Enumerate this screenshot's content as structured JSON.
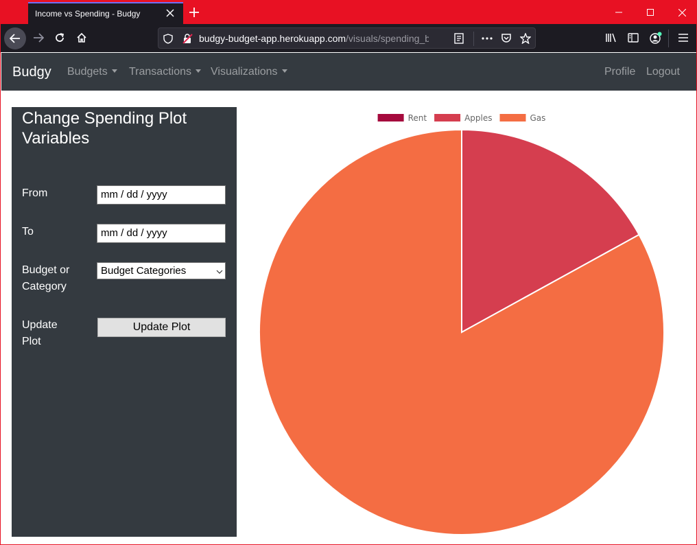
{
  "browser": {
    "tab_title": "Income vs Spending - Budgy",
    "url_host": "budgy-budget-app.herokuapp.com",
    "url_path": "/visuals/spending_b"
  },
  "site": {
    "brand": "Budgy",
    "nav_left": [
      "Budgets",
      "Transactions",
      "Visualizations"
    ],
    "nav_right": [
      "Profile",
      "Logout"
    ]
  },
  "sidebar": {
    "title": "Change Spending Plot Variables",
    "from_label": "From",
    "from_value": "mm / dd / yyyy",
    "to_label": "To",
    "to_value": "mm / dd / yyyy",
    "budget_label": "Budget or Category",
    "budget_value": "Budget Categories",
    "update_label": "Update Plot",
    "update_button": "Update Plot"
  },
  "chart_data": {
    "type": "pie",
    "legend_position": "top",
    "categories": [
      "Rent",
      "Apples",
      "Gas"
    ],
    "values": [
      0,
      17,
      83
    ],
    "colors": [
      "#a50a3d",
      "#d53e4f",
      "#f46d43"
    ]
  }
}
